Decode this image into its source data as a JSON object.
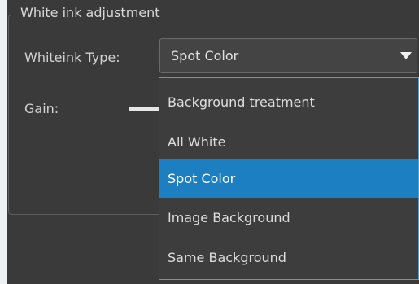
{
  "group": {
    "title": "White ink adjustment"
  },
  "whiteink_type": {
    "label": "Whiteink Type:",
    "selected": "Spot Color",
    "options": [
      "Background treatment",
      "All White",
      "Spot Color",
      "Image Background",
      "Same Background"
    ],
    "highlighted_index": 2
  },
  "gain": {
    "label": "Gain:"
  },
  "colors": {
    "panel_bg": "#3a3a3a",
    "accent": "#1c7fc1",
    "dropdown_border": "#4d9fd6"
  },
  "icons": {
    "combo_arrow": "chevron-down-icon"
  }
}
